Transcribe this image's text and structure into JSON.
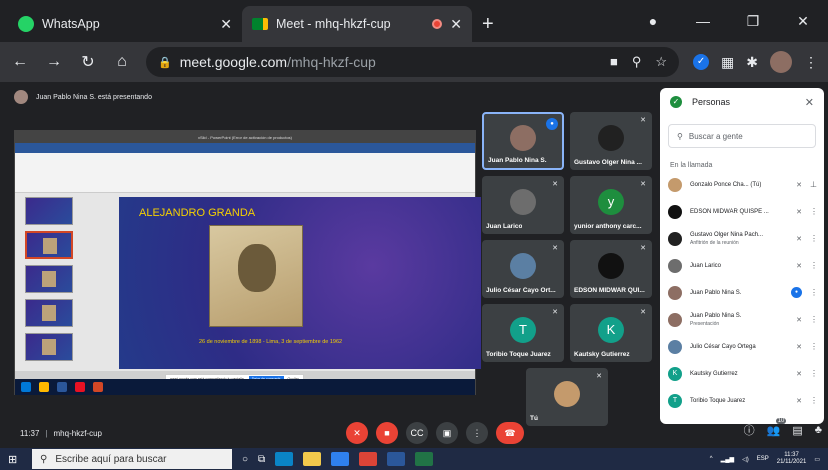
{
  "browser": {
    "tabs": [
      {
        "title": "WhatsApp",
        "active": false,
        "icon": "whatsapp-icon"
      },
      {
        "title": "Meet - mhq-hkzf-cup",
        "active": true,
        "icon": "meet-icon"
      }
    ],
    "url_domain": "meet.google.com",
    "url_path": "/mhq-hkzf-cup"
  },
  "meet": {
    "presenting_banner": "Juan Pablo Nina S. está presentando",
    "meeting_code": "mhq-hkzf-cup",
    "time": "11:37",
    "presentation": {
      "window_title": "xSlid - PowerPoint (Error de activación de productos)",
      "slide_title": "ALEJANDRO GRANDA",
      "slide_caption": "26 de noviembre de 1898 - Lima, 3 de septiembre de 1962",
      "sharing_text": "meet.google.com está compartiendo tu pantalla.",
      "stop_sharing": "Dejar de compartir",
      "hide": "Ocultar"
    },
    "tiles": [
      {
        "name": "Juan Pablo Nina S.",
        "speaking": true,
        "avatar_color": "#8d6e63",
        "initial": ""
      },
      {
        "name": "Gustavo Olger Nina ...",
        "speaking": false,
        "avatar_color": "#212121",
        "initial": ""
      },
      {
        "name": "Juan Larico",
        "speaking": false,
        "avatar_color": "#6d6d6d",
        "initial": ""
      },
      {
        "name": "yunior anthony carc...",
        "speaking": false,
        "avatar_color": "#1e8e3e",
        "initial": "y"
      },
      {
        "name": "Julio César Cayo Ort...",
        "speaking": false,
        "avatar_color": "#5b7fa3",
        "initial": ""
      },
      {
        "name": "EDSON MIDWAR QUI...",
        "speaking": false,
        "avatar_color": "#111111",
        "initial": ""
      },
      {
        "name": "Toribio Toque Juarez",
        "speaking": false,
        "avatar_color": "#12a08a",
        "initial": "T"
      },
      {
        "name": "Kautsky Gutierrez",
        "speaking": false,
        "avatar_color": "#12a08a",
        "initial": "K"
      },
      {
        "name": "Tú",
        "speaking": false,
        "avatar_color": "#c49a6c",
        "initial": ""
      }
    ],
    "people_panel": {
      "title": "Personas",
      "search_placeholder": "Buscar a gente",
      "section": "En la llamada",
      "people": [
        {
          "name": "Gonzalo Ponce Cha...",
          "extra": "(Tú)",
          "sub": "",
          "avatar_color": "#c49a6c",
          "initial": "",
          "status": "muted"
        },
        {
          "name": "EDSON MIDWAR QUISPE ...",
          "extra": "",
          "sub": "",
          "avatar_color": "#111111",
          "initial": "",
          "status": "muted"
        },
        {
          "name": "Gustavo Olger Nina Pach...",
          "extra": "",
          "sub": "Anfitrión de la reunión",
          "avatar_color": "#212121",
          "initial": "",
          "status": "muted"
        },
        {
          "name": "Juan Larico",
          "extra": "",
          "sub": "",
          "avatar_color": "#6d6d6d",
          "initial": "",
          "status": "muted"
        },
        {
          "name": "Juan Pablo Nina S.",
          "extra": "",
          "sub": "",
          "avatar_color": "#8d6e63",
          "initial": "",
          "status": "speaking"
        },
        {
          "name": "Juan Pablo Nina S.",
          "extra": "",
          "sub": "Presentación",
          "avatar_color": "#8d6e63",
          "initial": "",
          "status": "muted"
        },
        {
          "name": "Julio César Cayo Ortega",
          "extra": "",
          "sub": "",
          "avatar_color": "#5b7fa3",
          "initial": "",
          "status": "muted"
        },
        {
          "name": "Kautsky Gutierrez",
          "extra": "",
          "sub": "",
          "avatar_color": "#12a08a",
          "initial": "K",
          "status": "muted"
        },
        {
          "name": "Toribio Toque Juarez",
          "extra": "",
          "sub": "",
          "avatar_color": "#12a08a",
          "initial": "T",
          "status": "muted"
        }
      ]
    },
    "participant_count": "10"
  },
  "windows": {
    "search_placeholder": "Escribe aquí para buscar",
    "clock_time": "11:37",
    "clock_date": "21/11/2021",
    "language": "ESP"
  }
}
